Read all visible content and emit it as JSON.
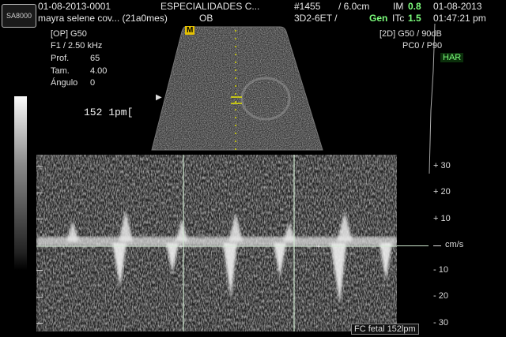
{
  "logo": {
    "text": "SA8000"
  },
  "header": {
    "date_id": "01-08-2013-0001",
    "clinic": "ESPECIALIDADES C...",
    "patient": "mayra selene cov... (21a0mes)",
    "exam": "OB",
    "frame_id": "#1455",
    "depth": "/ 6.0cm",
    "im_label": "IM",
    "im_value": "0.8",
    "date": "01-08-2013",
    "probe": "3D2-6ET /",
    "gen_label": "Gen",
    "itc_label": "ITc",
    "itc_value": "1.5",
    "time": "01:47:21 pm"
  },
  "left_params": {
    "op": "[OP]  G50",
    "f1": "F1 / 2.50 kHz",
    "prof_label": "Prof.",
    "prof_value": "65",
    "tam_label": "Tam.",
    "tam_value": "4.00",
    "angulo_label": "Ángulo",
    "angulo_value": "0"
  },
  "right_params": {
    "mode": "[2D]  G50 / 90dB",
    "pc": "PC0 / P90",
    "har": "HAR"
  },
  "readout": {
    "bpm": "152  1pm["
  },
  "marker": {
    "m": "M"
  },
  "velocity_scale": {
    "unit": "cm/s",
    "labels": [
      "+ 30",
      "+ 20",
      "+ 10",
      "- 10",
      "- 20",
      "- 30"
    ],
    "values": [
      30,
      20,
      10,
      -10,
      -20,
      -30
    ],
    "range": [
      -30,
      30
    ]
  },
  "footer": {
    "fc_label": "FC fetal 152lpm"
  },
  "colors": {
    "accent_green": "#7dff7d",
    "marker_yellow": "#e6c200",
    "cursor_line": "#cfe8cf"
  }
}
